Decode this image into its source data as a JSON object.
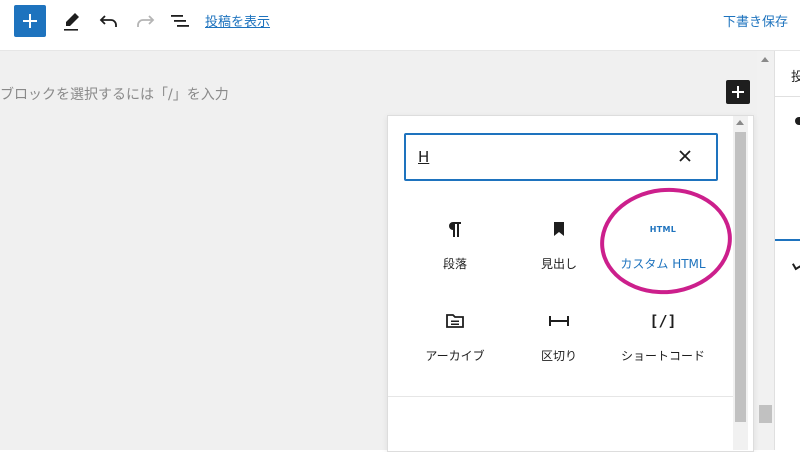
{
  "toolbar": {
    "view_post_label": "投稿を表示",
    "save_draft_label": "下書き保存",
    "accent_color": "#1e73be"
  },
  "canvas": {
    "placeholder": "ブロックを選択するには「/」を入力"
  },
  "sidebar": {
    "tab_label_partial": "投"
  },
  "inserter": {
    "search_value": "H",
    "blocks": [
      {
        "label": "段落",
        "icon": "paragraph-icon"
      },
      {
        "label": "見出し",
        "icon": "bookmark-icon"
      },
      {
        "label": "カスタム HTML",
        "icon": "html-icon",
        "icon_text": "HTML",
        "highlighted": true
      },
      {
        "label": "アーカイブ",
        "icon": "folder-icon"
      },
      {
        "label": "区切り",
        "icon": "separator-icon"
      },
      {
        "label": "ショートコード",
        "icon": "shortcode-icon",
        "icon_text": "[/]"
      }
    ]
  },
  "annotation_color": "#cc1f8c"
}
